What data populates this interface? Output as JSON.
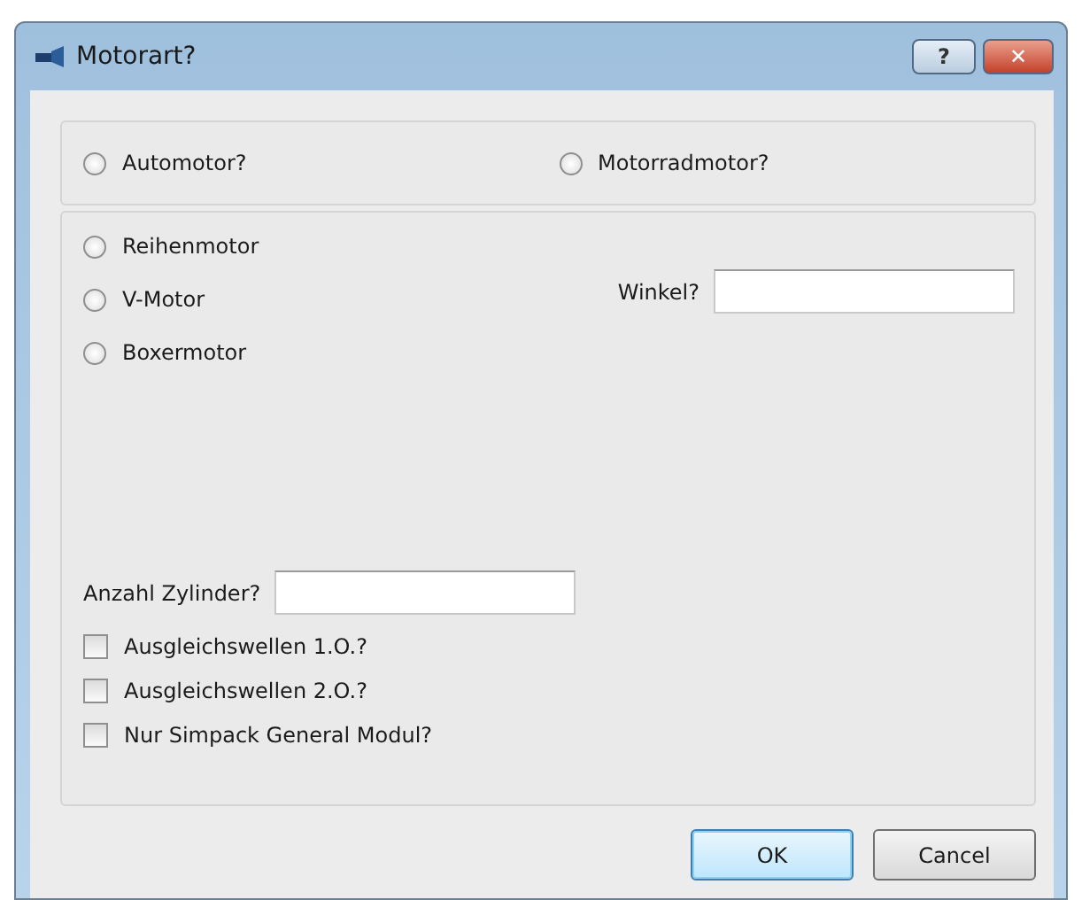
{
  "window": {
    "title": "Motorart?",
    "help_button": "?",
    "close_button": "✕"
  },
  "vehicle_type": [
    {
      "label": "Automotor?",
      "selected": false
    },
    {
      "label": "Motorradmotor?",
      "selected": false
    }
  ],
  "engine_layout": [
    {
      "label": "Reihenmotor",
      "selected": false
    },
    {
      "label": "V-Motor",
      "selected": false
    },
    {
      "label": "Boxermotor",
      "selected": false
    }
  ],
  "angle_field": {
    "label": "Winkel?"
  },
  "cylinder_field": {
    "label": "Anzahl Zylinder?"
  },
  "options": [
    {
      "label": "Ausgleichswellen 1.O.?",
      "checked": false
    },
    {
      "label": "Ausgleichswellen 2.O.?",
      "checked": false
    },
    {
      "label": "Nur Simpack General Modul?",
      "checked": false
    }
  ],
  "buttons": [
    {
      "label": "OK",
      "default": true
    },
    {
      "label": "Cancel",
      "default": false
    }
  ]
}
